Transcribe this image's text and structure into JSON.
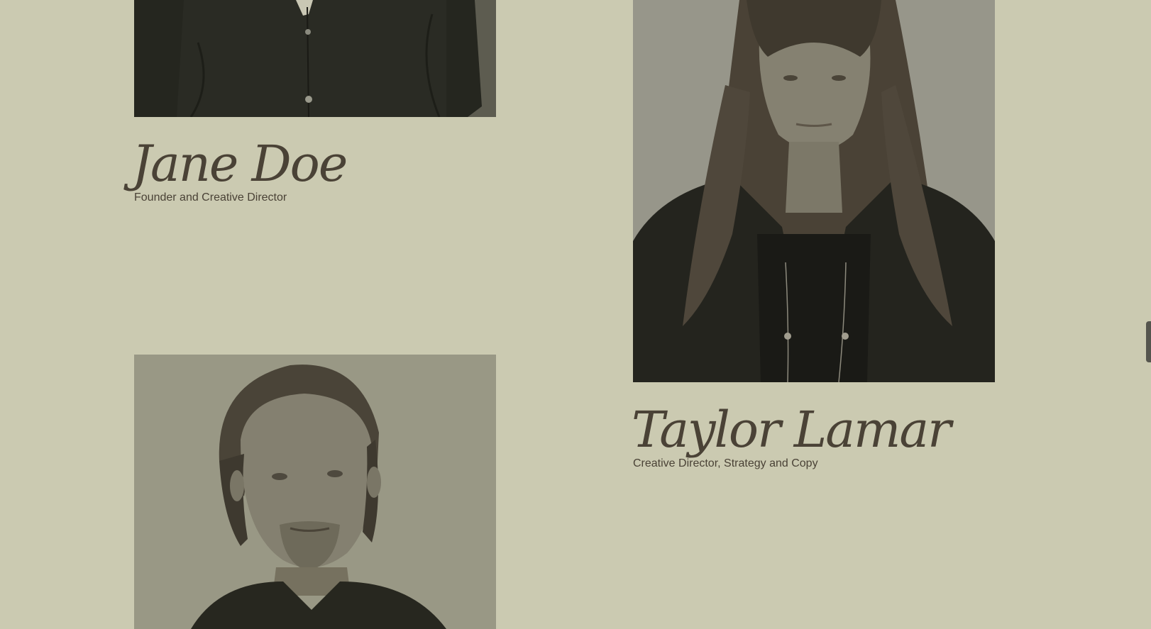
{
  "team": {
    "members": [
      {
        "name": "Jane Doe",
        "role": "Founder and Creative Director",
        "photo_icon": "portrait-photo"
      },
      {
        "name": "Taylor Lamar",
        "role": "Creative Director, Strategy and Copy",
        "photo_icon": "portrait-photo"
      },
      {
        "photo_icon": "portrait-photo"
      }
    ]
  },
  "colors": {
    "background": "#cbcab1",
    "text": "#4a4236",
    "photo_bg": "#9b9a86",
    "photo_dark": "#26261f"
  }
}
